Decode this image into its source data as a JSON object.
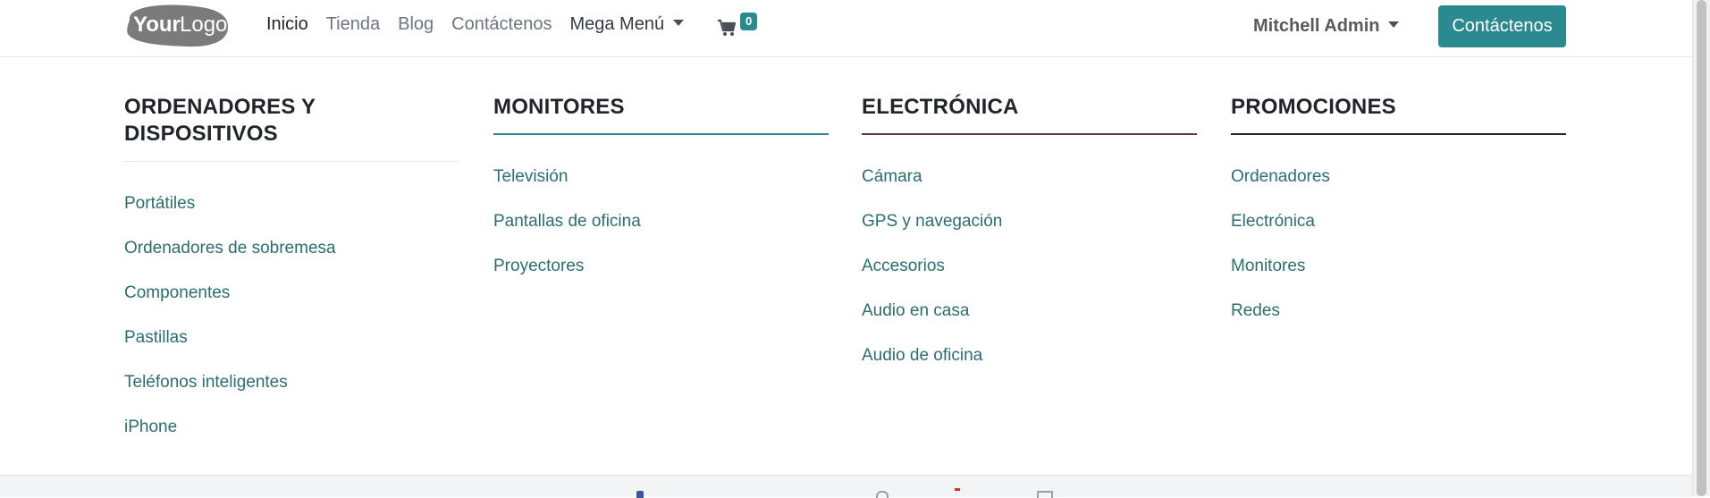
{
  "header": {
    "logo_text": "YourLogo",
    "nav": [
      "Inicio",
      "Tienda",
      "Blog",
      "Contáctenos"
    ],
    "mega_label": "Mega Menú",
    "cart_count": "0",
    "user_label": "Mitchell Admin",
    "cta_label": "Contáctenos"
  },
  "mega_menu": {
    "columns": [
      {
        "title_lines": [
          "ORDENADORES Y",
          "DISPOSITIVOS"
        ],
        "links": [
          "Portátiles",
          "Ordenadores de sobremesa",
          "Componentes",
          "Pastillas",
          "Teléfonos inteligentes",
          "iPhone"
        ]
      },
      {
        "title_lines": [
          "MONITORES"
        ],
        "links": [
          "Televisión",
          "Pantallas de oficina",
          "Proyectores"
        ]
      },
      {
        "title_lines": [
          "ELECTRÓNICA"
        ],
        "links": [
          "Cámara",
          "GPS y navegación",
          "Accesorios",
          "Audio en casa",
          "Audio de oficina"
        ]
      },
      {
        "title_lines": [
          "PROMOCIONES"
        ],
        "links": [
          "Ordenadores",
          "Electrónica",
          "Monitores",
          "Redes"
        ]
      }
    ]
  },
  "colors": {
    "accent": "#2b8a8f",
    "link": "#2b6e70",
    "rule_col1": "#e5e7ea",
    "rule_col2": "#2b8a8f",
    "rule_col3": "#5a3a3a",
    "rule_col4": "#212529"
  },
  "icons": {
    "cart": "shopping-cart-icon",
    "caret": "caret-down-icon"
  }
}
